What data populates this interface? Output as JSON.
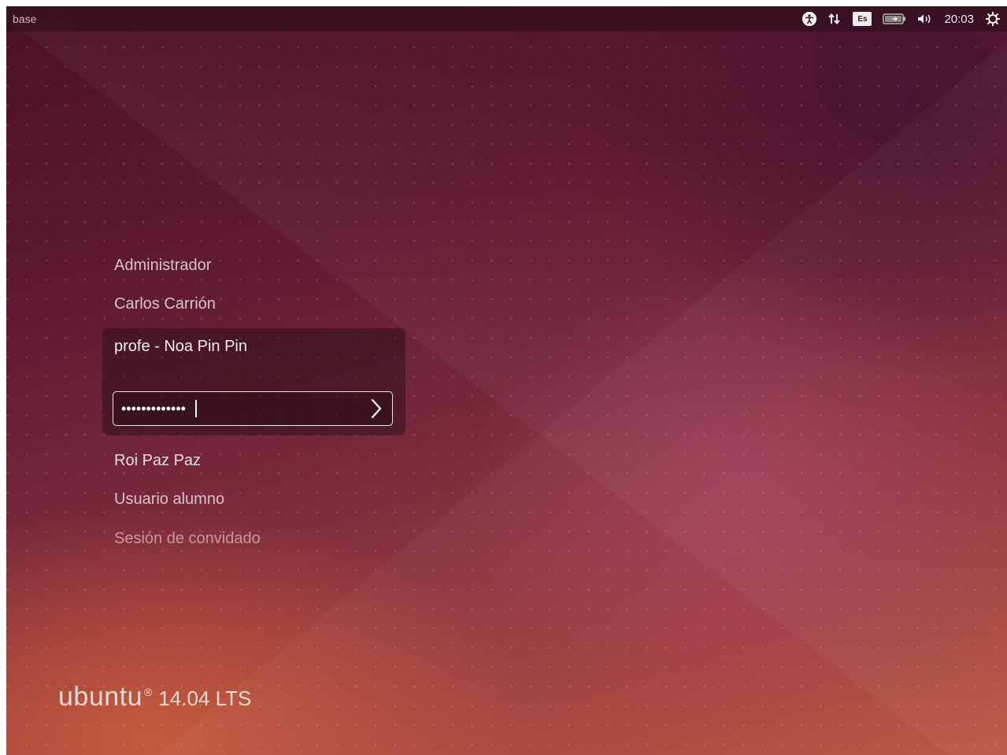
{
  "top_panel": {
    "hostname": "base",
    "keyboard_layout": "Es",
    "clock": "20:03",
    "icons": [
      "accessibility-icon",
      "network-icon",
      "keyboard-layout-icon",
      "battery-icon",
      "volume-icon",
      "power-icon"
    ]
  },
  "users": [
    {
      "name": "Administrador"
    },
    {
      "name": "Carlos Carrión"
    },
    {
      "name": "profe - Noa Pin Pin",
      "selected": true
    },
    {
      "name": "Roi Paz Paz"
    },
    {
      "name": "Usuario alumno"
    },
    {
      "name": "Sesión de convidado"
    }
  ],
  "login": {
    "password_mask": "•••••••••••••"
  },
  "branding": {
    "name": "ubuntu",
    "registered": "®",
    "version": "14.04 LTS"
  },
  "colors": {
    "background_dark": "#4a1226",
    "background_warm": "#b95a45",
    "text": "#e9dfe1"
  }
}
